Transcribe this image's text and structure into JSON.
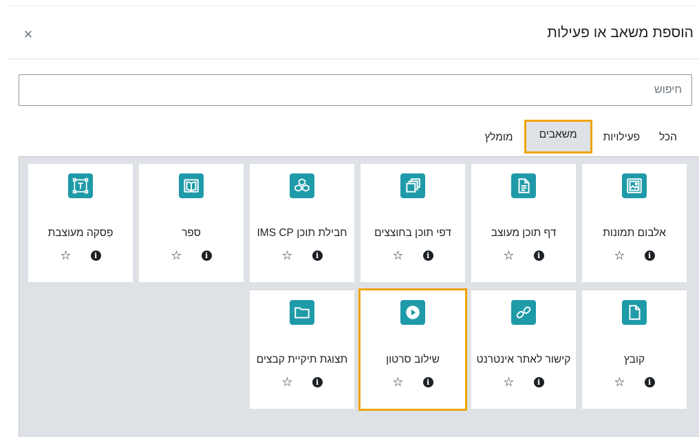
{
  "dialog": {
    "title": "הוספת משאב או פעילות",
    "close_symbol": "×"
  },
  "search": {
    "placeholder": "חיפוש"
  },
  "tabs": [
    {
      "label": "הכל"
    },
    {
      "label": "פעילויות"
    },
    {
      "label": "משאבים",
      "active": true
    },
    {
      "label": "מומלץ"
    }
  ],
  "colors": {
    "accent": "#f0a30a",
    "icon_bg": "#1f9aa8",
    "panel_bg": "#dee2e6"
  },
  "cards": [
    {
      "name": "אלבום תמונות",
      "icon": "image-gallery-icon"
    },
    {
      "name": "דף תוכן מעוצב",
      "icon": "page-icon"
    },
    {
      "name": "דפי תוכן בחוצצים",
      "icon": "tabbed-pages-icon"
    },
    {
      "name": "חבילת תוכן IMS CP",
      "icon": "ims-package-icon"
    },
    {
      "name": "ספר",
      "icon": "book-icon"
    },
    {
      "name": "פִסקה מעוצבת",
      "icon": "text-area-icon"
    },
    {
      "name": "קובץ",
      "icon": "file-icon"
    },
    {
      "name": "קישור לאתר אינטרנט",
      "icon": "link-icon"
    },
    {
      "name": "שילוב סרטון",
      "icon": "play-video-icon",
      "highlighted": true
    },
    {
      "name": "תצוגת תיקיית קבצים",
      "icon": "folder-icon"
    }
  ],
  "card_actions": {
    "info_symbol": "i",
    "star_symbol": "☆"
  }
}
